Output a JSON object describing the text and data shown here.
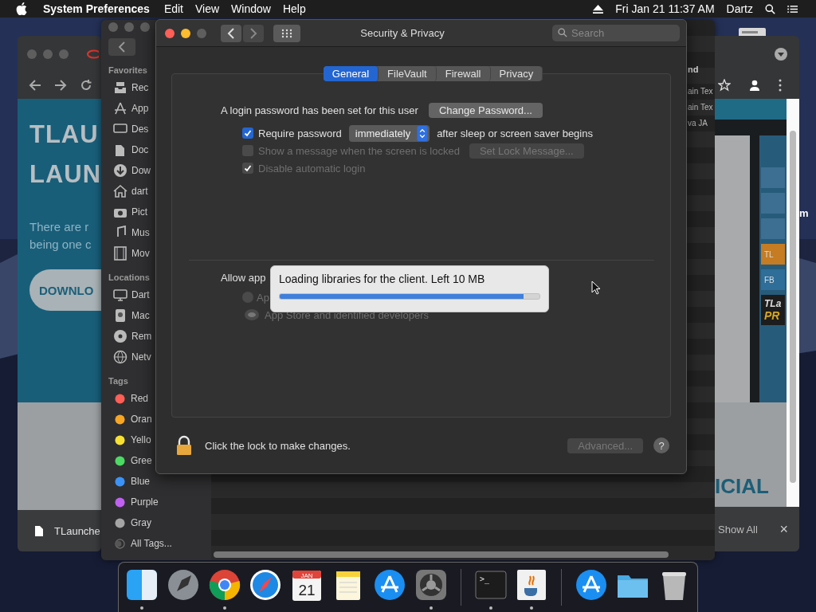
{
  "menubar": {
    "app": "System Preferences",
    "menus": [
      "Edit",
      "View",
      "Window",
      "Help"
    ],
    "clock": "Fri Jan 21  11:37 AM",
    "user": "Dartz"
  },
  "desktop_label": "m",
  "browser_left": {
    "heading_lines": [
      "TLAU",
      "LAUN"
    ],
    "text_lines": [
      "There are r",
      "being one c"
    ],
    "button": "DOWNLO",
    "download": "TLaunche"
  },
  "finder": {
    "sections": [
      {
        "title": "Favorites",
        "items": [
          {
            "label": "Rec",
            "kind": "recents"
          },
          {
            "label": "App",
            "kind": "apps"
          },
          {
            "label": "Des",
            "kind": "desktop"
          },
          {
            "label": "Doc",
            "kind": "documents"
          },
          {
            "label": "Dow",
            "kind": "downloads"
          },
          {
            "label": "dart",
            "kind": "home"
          },
          {
            "label": "Pict",
            "kind": "pictures"
          },
          {
            "label": "Mus",
            "kind": "music"
          },
          {
            "label": "Mov",
            "kind": "movies"
          }
        ]
      },
      {
        "title": "Locations",
        "items": [
          {
            "label": "Dart",
            "kind": "computer"
          },
          {
            "label": "Mac",
            "kind": "disk"
          },
          {
            "label": "Rem",
            "kind": "disc"
          },
          {
            "label": "Netv",
            "kind": "network"
          }
        ]
      },
      {
        "title": "Tags",
        "items": [
          {
            "label": "Red",
            "kind": "tag",
            "color": "#ff5f57"
          },
          {
            "label": "Oran",
            "kind": "tag",
            "color": "#f5a623"
          },
          {
            "label": "Yello",
            "kind": "tag",
            "color": "#f8e132"
          },
          {
            "label": "Gree",
            "kind": "tag",
            "color": "#4cd964"
          },
          {
            "label": "Blue",
            "kind": "tag",
            "color": "#3b93f7"
          },
          {
            "label": "Purple",
            "kind": "tag",
            "color": "#c061f2"
          },
          {
            "label": "Gray",
            "kind": "tag",
            "color": "#a5a5a5"
          },
          {
            "label": "All Tags...",
            "kind": "all-tags"
          }
        ]
      }
    ],
    "column_header": "nd",
    "rows": [
      "ain Tex",
      "ain Tex",
      "va JA"
    ]
  },
  "browser_right": {
    "side_buttons": [
      "TL",
      "FB"
    ],
    "promo": [
      "TLa",
      "PR"
    ],
    "banner": "ICIAL",
    "show_all": "Show All",
    "close": "×"
  },
  "window": {
    "title": "Security & Privacy",
    "search": {
      "placeholder": "Search"
    },
    "tabs": [
      {
        "label": "General",
        "selected": true
      },
      {
        "label": "FileVault",
        "selected": false
      },
      {
        "label": "Firewall",
        "selected": false
      },
      {
        "label": "Privacy",
        "selected": false
      }
    ],
    "login_text": "A login password has been set for this user",
    "change_password": "Change Password...",
    "options": [
      {
        "kind": "select",
        "label": "Require password",
        "checked": true,
        "disabled": false,
        "value": "immediately",
        "suffix": "after sleep or screen saver begins"
      },
      {
        "kind": "button",
        "label": "Show a message when the screen is locked",
        "checked": false,
        "disabled": true,
        "button": "Set Lock Message..."
      },
      {
        "kind": "plain",
        "label": "Disable automatic login",
        "checked": true,
        "disabled": true
      }
    ],
    "allow_label": "Allow app",
    "radios": [
      {
        "label": "Ap",
        "selected": false,
        "disabled": true
      },
      {
        "label": "App Store and identified developers",
        "selected": true,
        "disabled": true
      }
    ],
    "lock_text": "Click the lock to make changes.",
    "advanced": {
      "label": "Advanced...",
      "disabled": true
    },
    "help": "?"
  },
  "progress": {
    "message": "Loading libraries for the client. Left 10 MB",
    "level": 0.94
  },
  "dock": [
    {
      "kind": "finder",
      "running": true
    },
    {
      "kind": "launchpad",
      "running": false
    },
    {
      "kind": "chrome",
      "running": true
    },
    {
      "kind": "safari",
      "running": false
    },
    {
      "kind": "calendar",
      "running": false,
      "month": "JAN",
      "day": "21"
    },
    {
      "kind": "notes",
      "running": false
    },
    {
      "kind": "appstore",
      "running": false
    },
    {
      "kind": "sysprefs",
      "running": true
    },
    {
      "kind": "separator"
    },
    {
      "kind": "terminal",
      "running": true,
      "prompt": ">_"
    },
    {
      "kind": "java",
      "running": true
    },
    {
      "kind": "separator"
    },
    {
      "kind": "appstore",
      "running": false
    },
    {
      "kind": "folder",
      "running": false
    },
    {
      "kind": "trash",
      "running": false
    }
  ]
}
